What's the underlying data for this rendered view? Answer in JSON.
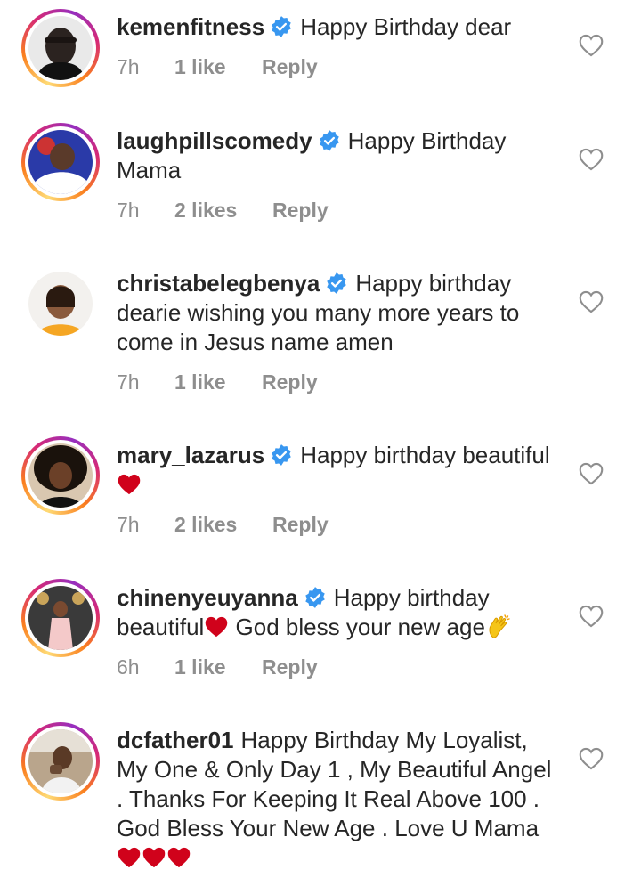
{
  "comments": [
    {
      "username": "kemenfitness",
      "verified": true,
      "text": "Happy Birthday dear",
      "time": "7h",
      "likes": "1 like",
      "reply": "Reply",
      "story_ring": true
    },
    {
      "username": "laughpillscomedy",
      "verified": true,
      "text": "Happy Birthday Mama",
      "time": "7h",
      "likes": "2 likes",
      "reply": "Reply",
      "story_ring": true
    },
    {
      "username": "christabelegbenya",
      "verified": true,
      "text": "Happy birthday dearie wishing you many more years to come in Jesus name amen",
      "time": "7h",
      "likes": "1 like",
      "reply": "Reply",
      "story_ring": false
    },
    {
      "username": "mary_lazarus",
      "verified": true,
      "text": "Happy birthday beautiful",
      "time": "7h",
      "likes": "2 likes",
      "reply": "Reply",
      "story_ring": true
    },
    {
      "username": "chinenyeuyanna",
      "verified": true,
      "text_part1": "Happy birthday beautiful",
      "text_part2": " God bless your new age",
      "time": "6h",
      "likes": "1 like",
      "reply": "Reply",
      "story_ring": true
    },
    {
      "username": "dcfather01",
      "verified": false,
      "text": "Happy Birthday My Loyalist, My One & Only Day 1 , My Beautiful Angel . Thanks For Keeping It Real Above 100 . God Bless Your New Age . Love U Mama",
      "story_ring": true
    }
  ],
  "colors": {
    "text": "#262626",
    "meta": "#8e8e8e",
    "verified_blue": "#3897f0",
    "emoji_red": "#d0021b"
  },
  "icons": {
    "verified": "verified-badge-icon",
    "like": "heart-outline-icon",
    "emoji_heart": "red-heart-emoji",
    "emoji_clap": "clapping-hands-emoji"
  }
}
